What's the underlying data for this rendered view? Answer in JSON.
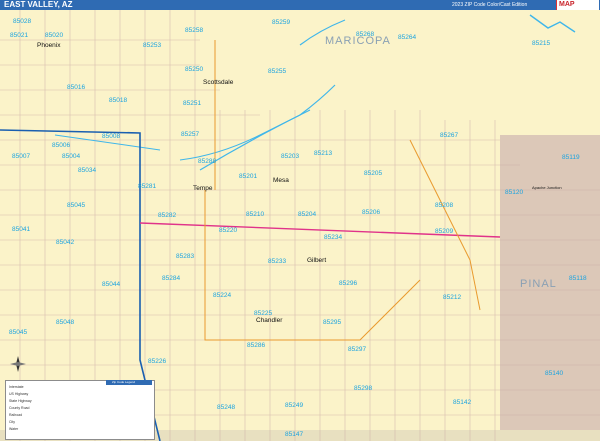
{
  "header": {
    "title": "EAST VALLEY, AZ",
    "edition": "2023 ZIP Code Color/Cast Edition",
    "brand": "MAP",
    "colors": {
      "bar": "#2f6bb3",
      "map_bg": "#fbf3c9",
      "pinal": "#dcc8b8",
      "zip": "#1aa3e0",
      "water": "#3fb6ea",
      "freeway": "#1a5fb0"
    }
  },
  "counties": [
    {
      "name": "MARICOPA"
    },
    {
      "name": "PINAL"
    }
  ],
  "cities": [
    {
      "name": "Phoenix"
    },
    {
      "name": "Scottsdale"
    },
    {
      "name": "Tempe"
    },
    {
      "name": "Mesa"
    },
    {
      "name": "Gilbert"
    },
    {
      "name": "Chandler"
    },
    {
      "name": "Apache Junction"
    }
  ],
  "zips": [
    "85028",
    "85259",
    "85268",
    "85264",
    "85215",
    "85021",
    "85020",
    "85253",
    "85258",
    "85255",
    "85250",
    "85016",
    "85018",
    "85251",
    "85257",
    "85267",
    "85008",
    "85006",
    "85007",
    "85004",
    "85034",
    "85281",
    "85288",
    "85201",
    "85203",
    "85213",
    "85205",
    "85119",
    "85120",
    "85045",
    "85282",
    "85210",
    "85204",
    "85206",
    "85208",
    "85041",
    "85042",
    "85220",
    "85234",
    "85209",
    "85283",
    "85233",
    "85044",
    "85284",
    "85296",
    "85212",
    "85118",
    "85224",
    "85225",
    "85045",
    "85048",
    "85286",
    "85295",
    "85226",
    "85297",
    "85140",
    "85298",
    "85248",
    "85249",
    "85142",
    "85147"
  ],
  "legend": {
    "title": "Zip Code Legend",
    "items": [
      "Interstate",
      "US Highway",
      "State Highway",
      "County Road",
      "Railroad",
      "City",
      "Water"
    ]
  }
}
